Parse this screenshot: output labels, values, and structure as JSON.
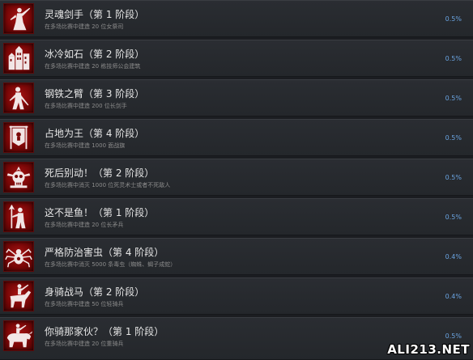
{
  "achievements": [
    {
      "name": "灵魂剑手（第 1 阶段）",
      "description": "在多场比赛中建造 20 位女祭司",
      "percent": "0.5%",
      "icon": "swordswoman-icon"
    },
    {
      "name": "冰冷如石（第 2 阶段）",
      "description": "在多场比赛中建造 20 栋技师公会建筑",
      "percent": "0.5%",
      "icon": "building-icon"
    },
    {
      "name": "钢铁之臂（第 3 阶段）",
      "description": "在多场比赛中建造 200 位长剑手",
      "percent": "0.5%",
      "icon": "swordsman-icon"
    },
    {
      "name": "占地为王（第 4 阶段）",
      "description": "在多场比赛中建造 1000 面战旗",
      "percent": "0.5%",
      "icon": "banner-icon"
    },
    {
      "name": "死后别动！（第 2 阶段）",
      "description": "在多场比赛中消灭 1000 位死灵术士或者不死敌人",
      "percent": "0.5%",
      "icon": "skull-icon"
    },
    {
      "name": "这不是鱼！（第 1 阶段）",
      "description": "在多场比赛中建造 20 位长矛兵",
      "percent": "0.5%",
      "icon": "spearman-icon"
    },
    {
      "name": "严格防治害虫（第 4 阶段）",
      "description": "在多场比赛中消灭 5000 条毒虫（蜘蛛、蝎子成蛇）",
      "percent": "0.4%",
      "icon": "spider-icon"
    },
    {
      "name": "身骑战马（第 2 阶段）",
      "description": "在多场比赛中建造 50 位轻骑兵",
      "percent": "0.4%",
      "icon": "horseman-icon"
    },
    {
      "name": "你骑那家伙？（第 1 阶段）",
      "description": "在多场比赛中建造 20 位重骑兵",
      "percent": "0.5%",
      "icon": "beast-rider-icon"
    }
  ],
  "watermark": "ALI213.NET"
}
